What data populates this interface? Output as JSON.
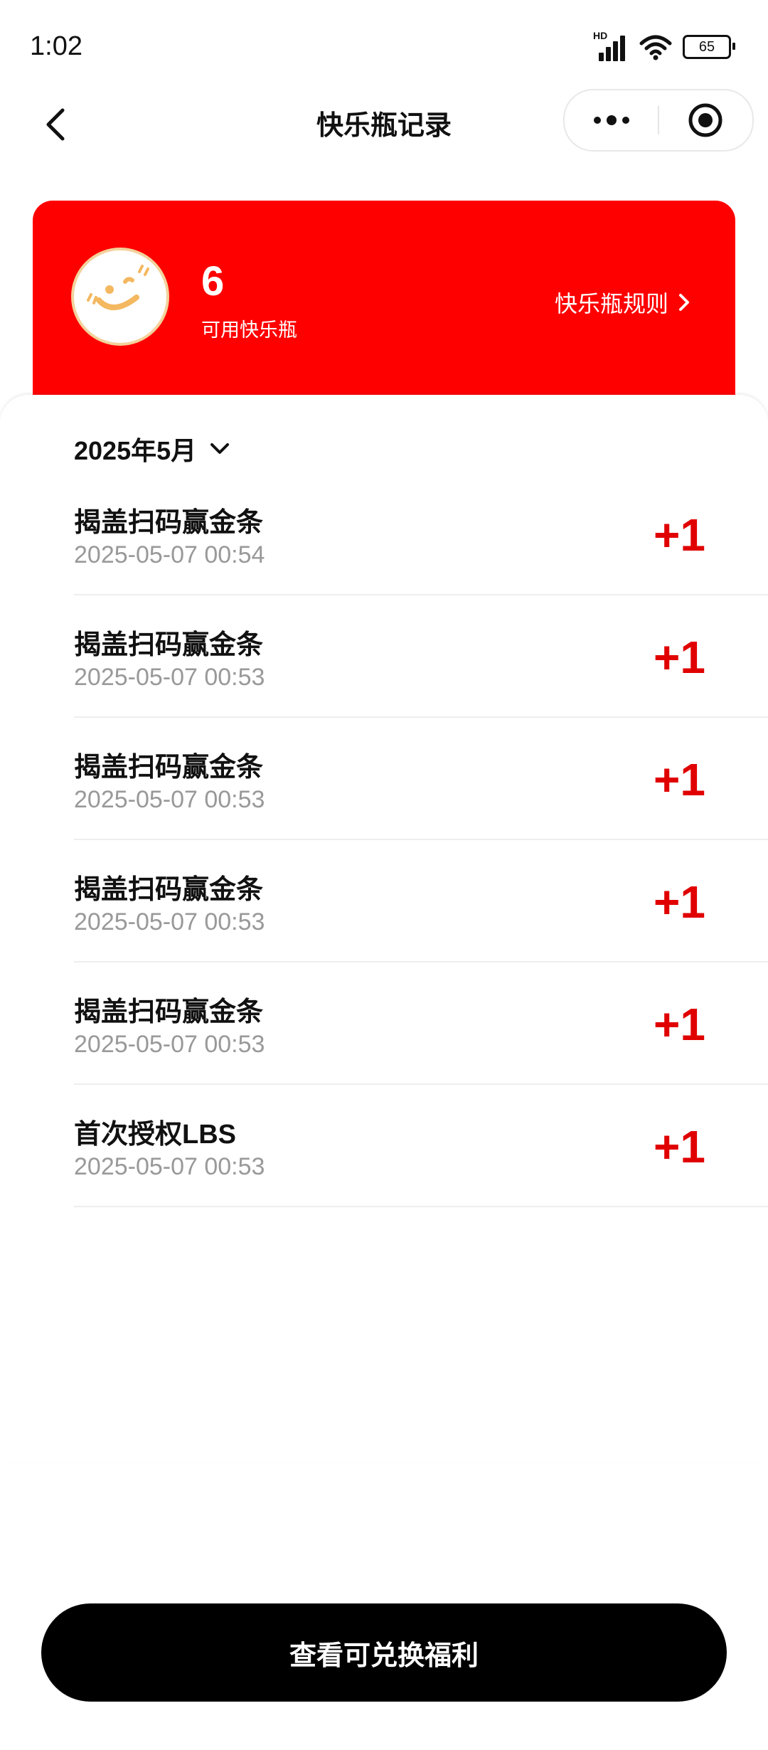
{
  "status_bar": {
    "time": "1:02",
    "signal_label": "HD",
    "battery": "65"
  },
  "nav": {
    "title": "快乐瓶记录"
  },
  "card": {
    "count": "6",
    "count_label": "可用快乐瓶",
    "rules_link": "快乐瓶规则"
  },
  "filter": {
    "month": "2025年5月"
  },
  "records": [
    {
      "title": "揭盖扫码赢金条",
      "time": "2025-05-07 00:54",
      "points": "+1"
    },
    {
      "title": "揭盖扫码赢金条",
      "time": "2025-05-07 00:53",
      "points": "+1"
    },
    {
      "title": "揭盖扫码赢金条",
      "time": "2025-05-07 00:53",
      "points": "+1"
    },
    {
      "title": "揭盖扫码赢金条",
      "time": "2025-05-07 00:53",
      "points": "+1"
    },
    {
      "title": "揭盖扫码赢金条",
      "time": "2025-05-07 00:53",
      "points": "+1"
    },
    {
      "title": "首次授权LBS",
      "time": "2025-05-07 00:53",
      "points": "+1"
    }
  ],
  "bottom_button": "查看可兑换福利",
  "colors": {
    "brand_red": "#ff0000",
    "points_red": "#e00000",
    "button_black": "#000000"
  },
  "icons": [
    "back-arrow-icon",
    "more-dots-icon",
    "target-icon",
    "chevron-right-icon",
    "chevron-down-icon",
    "smiley-avatar-icon",
    "wifi-icon",
    "cell-signal-icon",
    "battery-icon"
  ]
}
